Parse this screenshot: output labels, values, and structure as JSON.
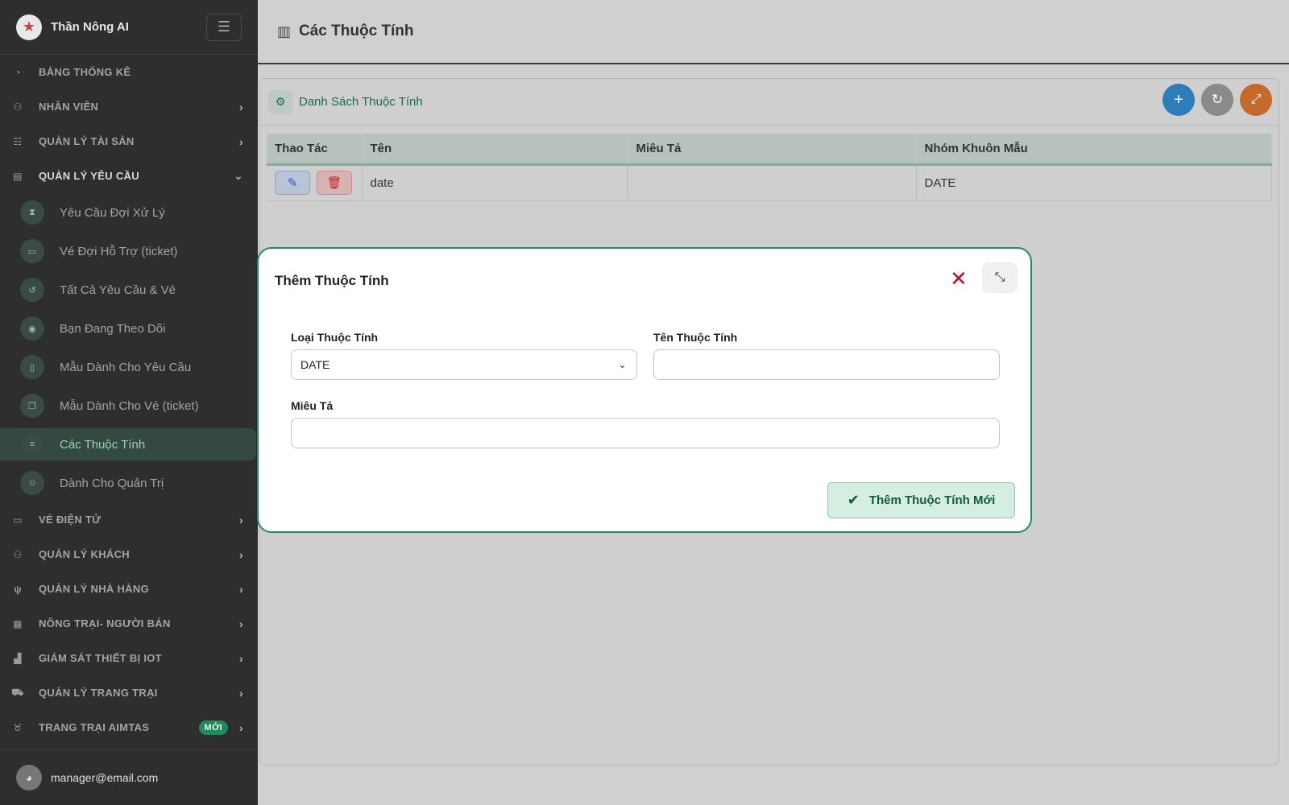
{
  "app": {
    "title": "Thần Nông AI",
    "user_email": "manager@email.com"
  },
  "sidebar": {
    "items": [
      {
        "label": "BẢNG THỐNG KÊ",
        "icon": "gauge-icon",
        "chevron": ""
      },
      {
        "label": "NHÂN VIÊN",
        "icon": "users-icon",
        "chevron": "›"
      },
      {
        "label": "QUẢN LÝ TÀI SẢN",
        "icon": "sitemap-icon",
        "chevron": "›"
      },
      {
        "label": "QUẢN LÝ YÊU CẦU",
        "icon": "clipboard-icon",
        "chevron": "⌄"
      }
    ],
    "subitems": [
      {
        "label": "Yêu Cầu Đợi Xử Lý",
        "icon": "hourglass-icon"
      },
      {
        "label": "Vé Đợi Hỗ Trợ (ticket)",
        "icon": "ticket-icon"
      },
      {
        "label": "Tất Cả Yêu Cầu & Vé",
        "icon": "history-icon"
      },
      {
        "label": "Bạn Đang Theo Dõi",
        "icon": "eye-icon"
      },
      {
        "label": "Mẫu Dành Cho Yêu Cầu",
        "icon": "file-icon"
      },
      {
        "label": "Mẫu Dành Cho Vé (ticket)",
        "icon": "copy-icon"
      },
      {
        "label": "Các Thuộc Tính",
        "icon": "sliders-icon"
      },
      {
        "label": "Dành Cho Quản Trị",
        "icon": "admin-icon"
      }
    ],
    "items_after": [
      {
        "label": "VÉ ĐIỆN TỬ",
        "icon": "ticket-icon"
      },
      {
        "label": "QUẢN LÝ KHÁCH",
        "icon": "group-icon"
      },
      {
        "label": "QUẢN LÝ NHÀ HÀNG",
        "icon": "utensils-icon"
      },
      {
        "label": "NÔNG TRẠI- NGƯỜI BÁN",
        "icon": "store-icon"
      },
      {
        "label": "GIÁM SÁT THIẾT BỊ IOT",
        "icon": "factory-icon"
      },
      {
        "label": "QUẢN LÝ TRANG TRẠI",
        "icon": "tractor-icon"
      },
      {
        "label": "TRANG TRẠI AIMTAS",
        "icon": "cow-icon",
        "badge": "MỚI"
      }
    ]
  },
  "header": {
    "title": "Các Thuộc Tính"
  },
  "card": {
    "title": "Danh Sách Thuộc Tính"
  },
  "table": {
    "columns": [
      "Thao Tác",
      "Tên",
      "Miêu Tả",
      "Nhóm Khuôn Mẫu"
    ],
    "rows": [
      {
        "name": "date",
        "description": "",
        "group": "DATE"
      }
    ]
  },
  "modal": {
    "title": "Thêm Thuộc Tính",
    "type_label": "Loại Thuộc Tính",
    "type_value": "DATE",
    "name_label": "Tên Thuộc Tính",
    "name_value": "",
    "desc_label": "Miêu Tả",
    "desc_value": "",
    "submit_label": "Thêm Thuộc Tính Mới"
  },
  "colors": {
    "accent": "#1f8a6a",
    "sidebar_bg": "#2e2e2e",
    "danger": "#c0102a"
  }
}
